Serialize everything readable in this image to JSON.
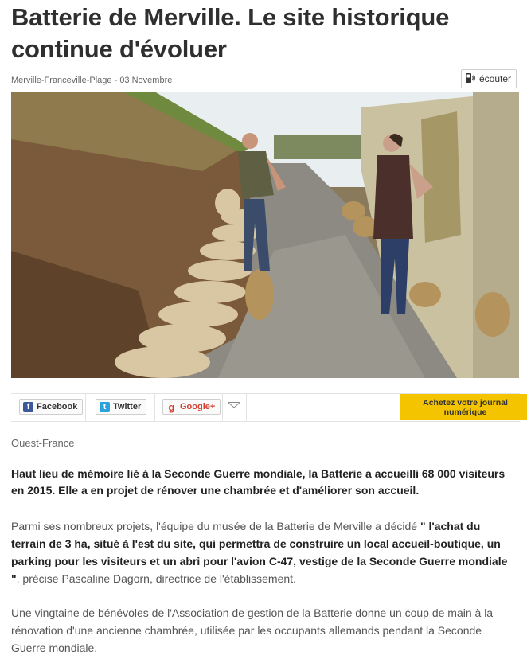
{
  "article": {
    "title": "Batterie de Merville. Le site historique continue d'évoluer",
    "meta": "Merville-Franceville-Plage - 03 Novembre",
    "listen_label": "écouter",
    "source": "Ouest-France",
    "lead": "Haut lieu de mémoire lié à la Seconde Guerre mondiale, la Batterie a accueilli 68 000 visiteurs en 2015. Elle a en projet de rénover une chambrée et d'améliorer son accueil.",
    "p1_start": "Parmi ses nombreux projets, l'équipe du musée de la Batterie de Merville a décidé ",
    "p1_quote": "\" l'achat du terrain de 3 ha, situé à l'est du site, qui permettra de construire un local accueil-boutique, un parking pour les visiteurs et un abri pour l'avion C-47, vestige de la Seconde Guerre mondiale \"",
    "p1_end": ", précise Pascaline Dagorn, directrice de l'établissement.",
    "p2": "Une vingtaine de bénévoles de l'Association de gestion de la Batterie donne un coup de main à la rénovation d'une ancienne chambrée, utilisée par les occupants allemands pendant la Seconde Guerre mondiale."
  },
  "share": {
    "facebook": "Facebook",
    "twitter": "Twitter",
    "google": "Google+",
    "buy_line1": "Achetez votre journal",
    "buy_line2": "numérique"
  },
  "icons": {
    "listen": "speaker-icon",
    "facebook": "facebook-icon",
    "twitter": "twitter-icon",
    "google": "google-plus-icon",
    "mail": "mail-icon"
  },
  "colors": {
    "buy_button": "#f5c400",
    "facebook": "#3b5998",
    "twitter": "#2aa3dc",
    "google": "#d23f31"
  }
}
